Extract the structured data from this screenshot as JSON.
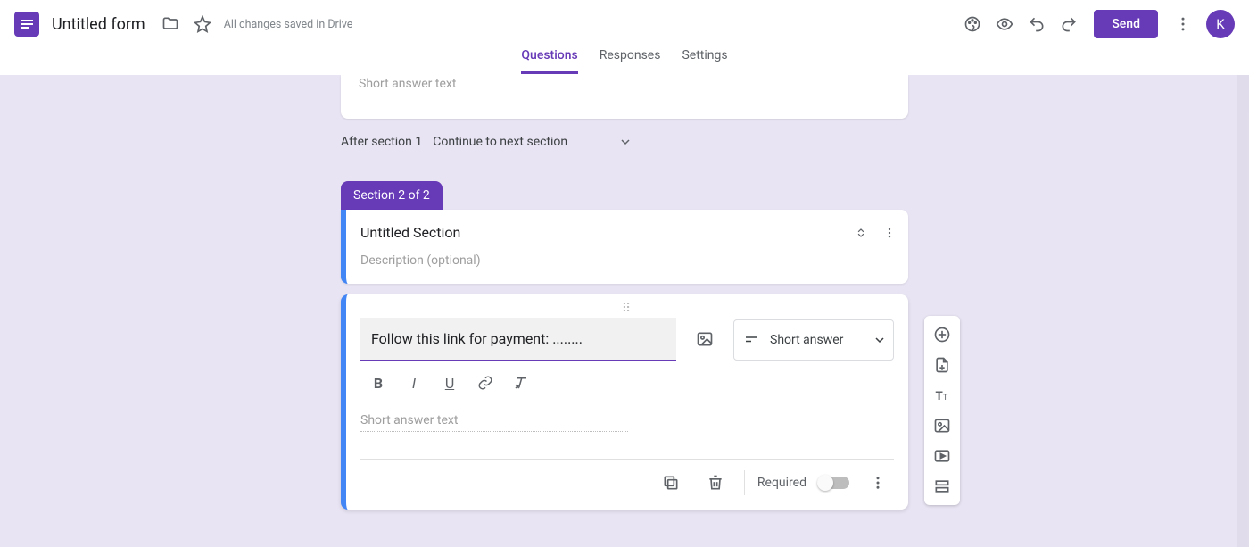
{
  "header": {
    "title": "Untitled form",
    "saved_status": "All changes saved in Drive",
    "send_label": "Send",
    "avatar_initial": "K"
  },
  "tabs": {
    "questions": "Questions",
    "responses": "Responses",
    "settings": "Settings"
  },
  "prev_question": {
    "short_answer_placeholder": "Short answer text"
  },
  "section_nav": {
    "after_label": "After section 1",
    "continue_label": "Continue to next section"
  },
  "section2": {
    "badge": "Section 2 of 2",
    "title": "Untitled Section",
    "description_placeholder": "Description (optional)"
  },
  "active_question": {
    "text": "Follow this link for payment: ........",
    "type_label": "Short answer",
    "answer_placeholder": "Short answer text",
    "required_label": "Required"
  }
}
